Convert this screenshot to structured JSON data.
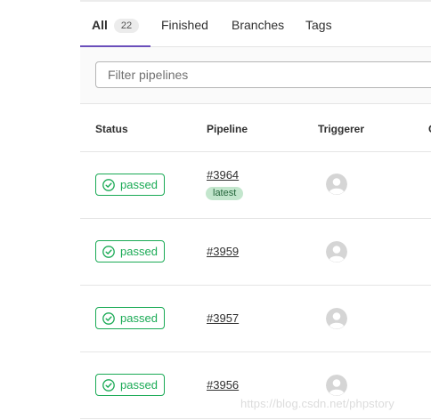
{
  "tabs": [
    {
      "label": "All",
      "count": "22",
      "active": true
    },
    {
      "label": "Finished"
    },
    {
      "label": "Branches"
    },
    {
      "label": "Tags"
    }
  ],
  "filter": {
    "placeholder": "Filter pipelines",
    "value": ""
  },
  "table": {
    "headers": {
      "status": "Status",
      "pipeline": "Pipeline",
      "triggerer": "Triggerer",
      "commit": "C"
    },
    "rows": [
      {
        "status": "passed",
        "pipeline_id": "#3964",
        "badge": "latest",
        "triggerer_avatar": "user-avatar-icon"
      },
      {
        "status": "passed",
        "pipeline_id": "#3959",
        "triggerer_avatar": "user-avatar-icon"
      },
      {
        "status": "passed",
        "pipeline_id": "#3957",
        "triggerer_avatar": "user-avatar-icon"
      },
      {
        "status": "passed",
        "pipeline_id": "#3956",
        "triggerer_avatar": "user-avatar-icon"
      }
    ]
  },
  "colors": {
    "accent": "#6b4fbb",
    "success": "#1aaa55",
    "latest_bg": "#c3e6cd"
  },
  "watermark": "https://blog.csdn.net/phpstory"
}
